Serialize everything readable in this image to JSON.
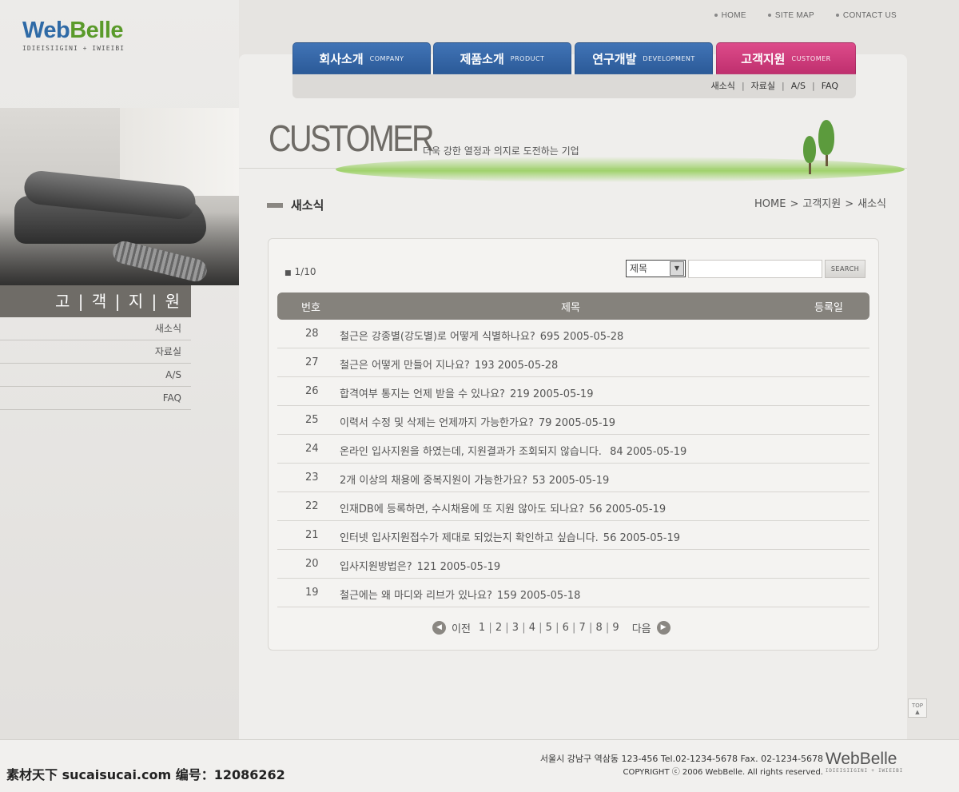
{
  "brand": {
    "logo_web": "Web",
    "logo_belle": "Belle",
    "logo_sub": "IDIEISIIGINI + IWIEIBI"
  },
  "util_links": [
    "HOME",
    "SITE MAP",
    "CONTACT US"
  ],
  "nav": {
    "tabs": [
      {
        "ko": "회사소개",
        "en": "COMPANY"
      },
      {
        "ko": "제품소개",
        "en": "PRODUCT"
      },
      {
        "ko": "연구개발",
        "en": "DEVELOPMENT"
      },
      {
        "ko": "고객지원",
        "en": "CUSTOMER"
      }
    ],
    "sub": [
      "새소식",
      "자료실",
      "A/S",
      "FAQ"
    ],
    "active_color": "#cf3b7c",
    "tab_color": "#3366a8"
  },
  "banner": {
    "title": "CUSTOMER",
    "slogan": "더욱 강한 열정과 의지로 도전하는 기업"
  },
  "sidebar": {
    "title": "고 | 객 | 지 | 원",
    "items": [
      "새소식",
      "자료실",
      "A/S",
      "FAQ"
    ]
  },
  "section": {
    "title": "새소식",
    "breadcrumb": [
      "HOME",
      "고객지원",
      "새소식"
    ]
  },
  "board": {
    "page_count": "1/10",
    "search_select": "제목",
    "search_placeholder": "",
    "search_button": "SEARCH",
    "columns": [
      "번호",
      "제목",
      "등록일"
    ],
    "rows": [
      {
        "num": "28",
        "title": "철근은 강종별(강도별)로 어떻게 식별하나요?",
        "rest": "695 2005-05-28"
      },
      {
        "num": "27",
        "title": "철근은 어떻게 만들어 지나요?",
        "rest": "193 2005-05-28"
      },
      {
        "num": "26",
        "title": "합격여부 통지는 언제 받을 수 있나요?",
        "rest": "219 2005-05-19"
      },
      {
        "num": "25",
        "title": "이력서 수정 및 삭제는 언제까지 가능한가요?",
        "rest": "79 2005-05-19"
      },
      {
        "num": "24",
        "title": "온라인 입사지원을 하였는데, 지원결과가 조회되지 않습니다.",
        "rest": " 84 2005-05-19"
      },
      {
        "num": "23",
        "title": "2개 이상의 채용에 중복지원이 가능한가요?",
        "rest": "53 2005-05-19"
      },
      {
        "num": "22",
        "title": "인재DB에 등록하면, 수시채용에 또 지원 않아도 되나요?",
        "rest": "56 2005-05-19"
      },
      {
        "num": "21",
        "title": "인터넷 입사지원접수가 제대로 되었는지 확인하고 싶습니다.",
        "rest": "56 2005-05-19"
      },
      {
        "num": "20",
        "title": "입사지원방법은?",
        "rest": "121 2005-05-19"
      },
      {
        "num": "19",
        "title": "철근에는 왜 마디와 리브가 있나요?",
        "rest": "159 2005-05-18"
      }
    ],
    "pager": {
      "prev": "이전",
      "next": "다음",
      "pages": [
        "1",
        "2",
        "3",
        "4",
        "5",
        "6",
        "7",
        "8",
        "9"
      ]
    }
  },
  "top_button": "TOP",
  "footer": {
    "address": "서울시 강남구 역삼동 123-456 Tel.02-1234-5678 Fax. 02-1234-5678",
    "copyright": "COPYRIGHT ⓒ 2006 WebBelle. All rights reserved.",
    "logo": "WebBelle",
    "logo_sub": "IDIEISIIGINI + IWIEIBI"
  },
  "watermark": "素材天下 sucaisucai.com  编号：12086262"
}
